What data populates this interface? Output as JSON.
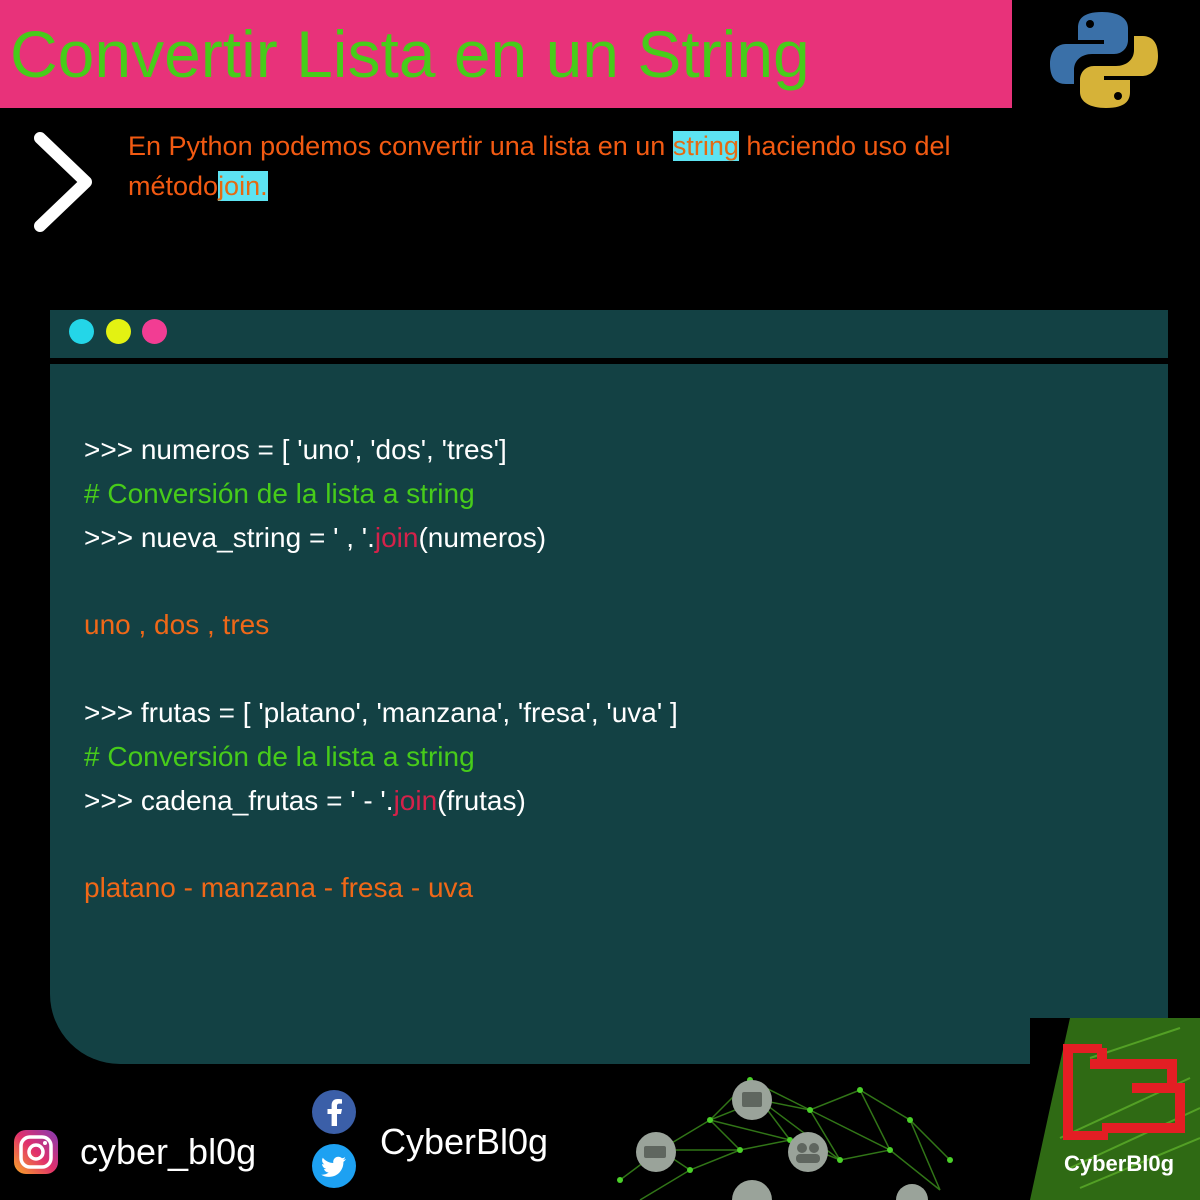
{
  "header": {
    "title": "Convertir Lista en un String"
  },
  "intro": {
    "before": "En Python podemos convertir una lista en un ",
    "highlight1": "string",
    "middle": " haciendo uso del método",
    "highlight2": "join."
  },
  "code": {
    "line1": ">>> numeros = [ 'uno', 'dos', 'tres']",
    "comment1": "# Conversión de la lista a string",
    "line2_pre": ">>> nueva_string = ' , '.",
    "line2_kw": "join",
    "line2_post": "(numeros)",
    "output1": "uno , dos , tres",
    "line3": ">>> frutas = [ 'platano', 'manzana', 'fresa', 'uva' ]",
    "comment2": "# Conversión de la lista a string",
    "line4_pre": ">>> cadena_frutas = ' - '.",
    "line4_kw": "join",
    "line4_post": "(frutas)",
    "output2": "platano - manzana - fresa - uva"
  },
  "footer": {
    "instagram_handle": "cyber_bl0g",
    "facebook_twitter_name": "CyberBl0g",
    "brand_name": "CyberBl0g"
  },
  "icons": {
    "chevron": "chevron-right-icon",
    "python": "python-logo",
    "instagram": "instagram-icon",
    "facebook": "facebook-icon",
    "twitter": "twitter-icon",
    "brand": "cyberblog-logo"
  },
  "colors": {
    "header_bg": "#e8327a",
    "title": "#47cc1a",
    "intro_text": "#f25a12",
    "highlight": "#5de3f2",
    "window_bg": "#134144",
    "comment": "#47cc1a",
    "output": "#f06818",
    "keyword": "#d4224a",
    "dot_cyan": "#24d6e8",
    "dot_yellow": "#e3f212",
    "dot_pink": "#f23d93"
  }
}
